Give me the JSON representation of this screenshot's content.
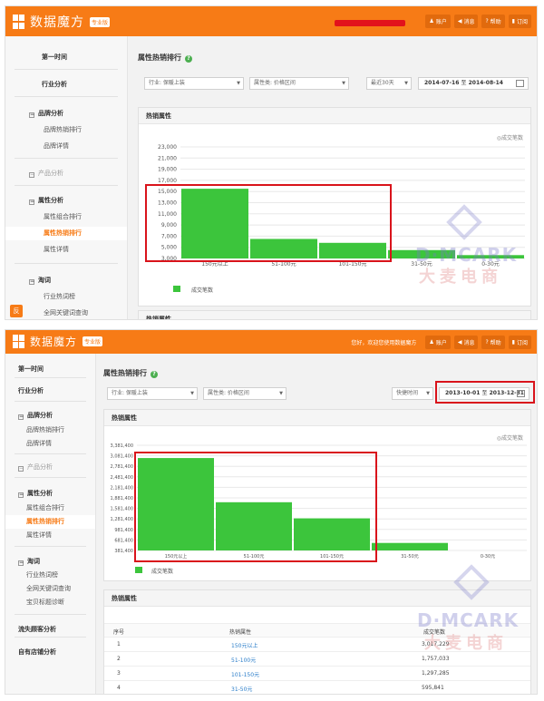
{
  "app": {
    "logo_text": "数据魔方",
    "edition": "专业版"
  },
  "screens": [
    {
      "toolbar": {
        "greeting": "",
        "buttons": [
          "账户",
          "消息",
          "帮助",
          "订阅"
        ]
      },
      "sidebar": {
        "items": [
          {
            "label": "第一时间",
            "type": "header"
          },
          {
            "label": "行业分析",
            "type": "header"
          },
          {
            "label": "品牌分析",
            "type": "group"
          },
          {
            "label": "品牌热销排行",
            "type": "sub"
          },
          {
            "label": "品牌详情",
            "type": "sub"
          },
          {
            "label": "产品分析",
            "type": "group-muted"
          },
          {
            "label": "属性分析",
            "type": "group"
          },
          {
            "label": "属性组合排行",
            "type": "sub"
          },
          {
            "label": "属性热销排行",
            "type": "active"
          },
          {
            "label": "属性详情",
            "type": "sub"
          },
          {
            "label": "淘词",
            "type": "group"
          },
          {
            "label": "行业热词榜",
            "type": "sub"
          },
          {
            "label": "全网关键词查询",
            "type": "sub"
          }
        ]
      },
      "page_title": "属性热销排行",
      "filters": {
        "industry": "行业: 保暖上装",
        "attribute": "属性类: 价格区间",
        "period": "最近30天",
        "date_from": "2014-07-16",
        "date_sep": "至",
        "date_to": "2014-08-14"
      },
      "card_title": "热销属性",
      "legend_right": "成交笔数",
      "legend_bottom": "成交笔数",
      "next_card_title": "热销属性",
      "watermark": {
        "brand": "D·MCARK",
        "cn": "大麦电商"
      },
      "chart_data": {
        "type": "bar",
        "title": "热销属性",
        "categories": [
          "150元以上",
          "51-100元",
          "101-150元",
          "31-50元",
          "0-30元"
        ],
        "series": [
          {
            "name": "成交笔数",
            "values": [
              15500,
              6500,
              5800,
              4500,
              3600
            ]
          }
        ],
        "yticks": [
          "23,000",
          "21,000",
          "19,000",
          "17,000",
          "15,000",
          "13,000",
          "11,000",
          "9,000",
          "7,000",
          "5,000",
          "3,000"
        ],
        "ylim": [
          3000,
          23000
        ],
        "grid": true,
        "color": "#3cc53c"
      }
    },
    {
      "toolbar": {
        "greeting": "您好，欢迎您使用数据魔方",
        "buttons": [
          "账户",
          "消息",
          "帮助",
          "订阅"
        ]
      },
      "sidebar": {
        "items": [
          {
            "label": "第一时间",
            "type": "header"
          },
          {
            "label": "行业分析",
            "type": "header"
          },
          {
            "label": "品牌分析",
            "type": "group"
          },
          {
            "label": "品牌热销排行",
            "type": "sub"
          },
          {
            "label": "品牌详情",
            "type": "sub"
          },
          {
            "label": "产品分析",
            "type": "group-muted"
          },
          {
            "label": "属性分析",
            "type": "group"
          },
          {
            "label": "属性组合排行",
            "type": "sub"
          },
          {
            "label": "属性热销排行",
            "type": "active"
          },
          {
            "label": "属性详情",
            "type": "sub"
          },
          {
            "label": "淘词",
            "type": "group"
          },
          {
            "label": "行业热词榜",
            "type": "sub"
          },
          {
            "label": "全网关键词查询",
            "type": "sub"
          },
          {
            "label": "宝贝标题诊断",
            "type": "sub"
          },
          {
            "label": "流失顾客分析",
            "type": "header"
          },
          {
            "label": "自有店铺分析",
            "type": "header"
          }
        ]
      },
      "page_title": "属性热销排行",
      "filters": {
        "industry": "行业: 保暖上装",
        "attribute": "属性类: 价格区间",
        "period": "快捷时间",
        "date_from": "2013-10-01",
        "date_sep": "至",
        "date_to": "2013-12-31"
      },
      "card_title": "热销属性",
      "legend_right": "成交笔数",
      "legend_bottom": "成交笔数",
      "table_title": "热销属性",
      "table_headers": [
        "序号",
        "热销属性",
        "成交笔数"
      ],
      "table_rows": [
        {
          "rank": "1",
          "attr": "150元以上",
          "count": "3,017,229"
        },
        {
          "rank": "2",
          "attr": "51-100元",
          "count": "1,757,033"
        },
        {
          "rank": "3",
          "attr": "101-150元",
          "count": "1,297,285"
        },
        {
          "rank": "4",
          "attr": "31-50元",
          "count": "595,841"
        }
      ],
      "watermark": {
        "brand": "D·MCARK",
        "cn": "大麦电商"
      },
      "chart_data": {
        "type": "bar",
        "title": "热销属性",
        "categories": [
          "150元以上",
          "51-100元",
          "101-150元",
          "31-50元",
          "0-30元"
        ],
        "series": [
          {
            "name": "成交笔数",
            "values": [
              3017229,
              1757033,
              1297285,
              595841,
              381400
            ]
          }
        ],
        "yticks": [
          "3,381,400",
          "3,081,400",
          "2,781,400",
          "2,481,400",
          "2,181,400",
          "1,881,400",
          "1,581,400",
          "1,281,400",
          "981,400",
          "681,400",
          "381,400"
        ],
        "ylim": [
          381400,
          3381400
        ],
        "grid": true,
        "color": "#3cc53c"
      }
    }
  ]
}
